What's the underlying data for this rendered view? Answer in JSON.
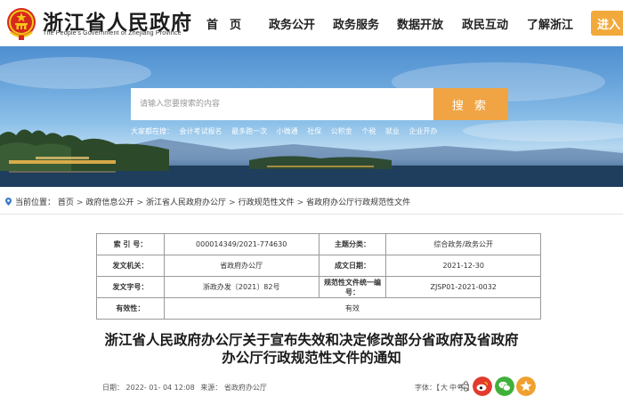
{
  "header": {
    "title": "浙江省人民政府",
    "subtitle": "The People's Government of Zhejiang Province",
    "nav": [
      {
        "label": "首　页"
      },
      {
        "label": "政务公开"
      },
      {
        "label": "政务服务"
      },
      {
        "label": "数据开放"
      },
      {
        "label": "政民互动"
      },
      {
        "label": "了解浙江"
      }
    ],
    "enter_label": "进入"
  },
  "search": {
    "placeholder": "请输入您要搜索的内容",
    "button_label": "搜 索",
    "quick_label": "大家都在搜：",
    "quick_links": [
      "会计考试报名",
      "最多跑一次",
      "小微通",
      "社保",
      "公积金",
      "个税",
      "就业",
      "企业开办"
    ]
  },
  "breadcrumb": {
    "label": "当前位置：",
    "items": [
      "首页",
      "政府信息公开",
      "浙江省人民政府办公厅",
      "行政规范性文件",
      "省政府办公厅行政规范性文件"
    ]
  },
  "meta": {
    "index_label": "索 引 号：",
    "index_value": "000014349/2021-774630",
    "topic_label": "主题分类：",
    "topic_value": "综合政务/政务公开",
    "issuer_label": "发文机关：",
    "issuer_value": "省政府办公厅",
    "date_label": "成文日期：",
    "date_value": "2021-12-30",
    "docno_label": "发文字号：",
    "docno_value": "浙政办发〔2021〕82号",
    "code_label": "规范性文件统一编号：",
    "code_value": "ZJSP01-2021-0032",
    "valid_label": "有效性：",
    "valid_value": "有效"
  },
  "doc": {
    "title_line1": "浙江省人民政府办公厅关于宣布失效和决定修改部分省政府及省政府",
    "title_line2": "办公厅行政规范性文件的通知",
    "date_label": "日期：",
    "date_value": "2022- 01- 04 12:08",
    "source_label": "来源：",
    "source_value": "省政府办公厅",
    "font_label": "字体：",
    "font_open": "【",
    "font_large": "大",
    "font_medium": "中",
    "font_small": "小",
    "font_close": "】"
  },
  "colors": {
    "accent_orange": "#f0a444",
    "weibo_red": "#e23b2e",
    "wechat_green": "#3fb13a",
    "favorite_orange": "#f0a030"
  },
  "icons": [
    "national-emblem-icon",
    "location-pin-icon",
    "share-icon",
    "weibo-icon",
    "wechat-icon",
    "favorite-icon"
  ]
}
